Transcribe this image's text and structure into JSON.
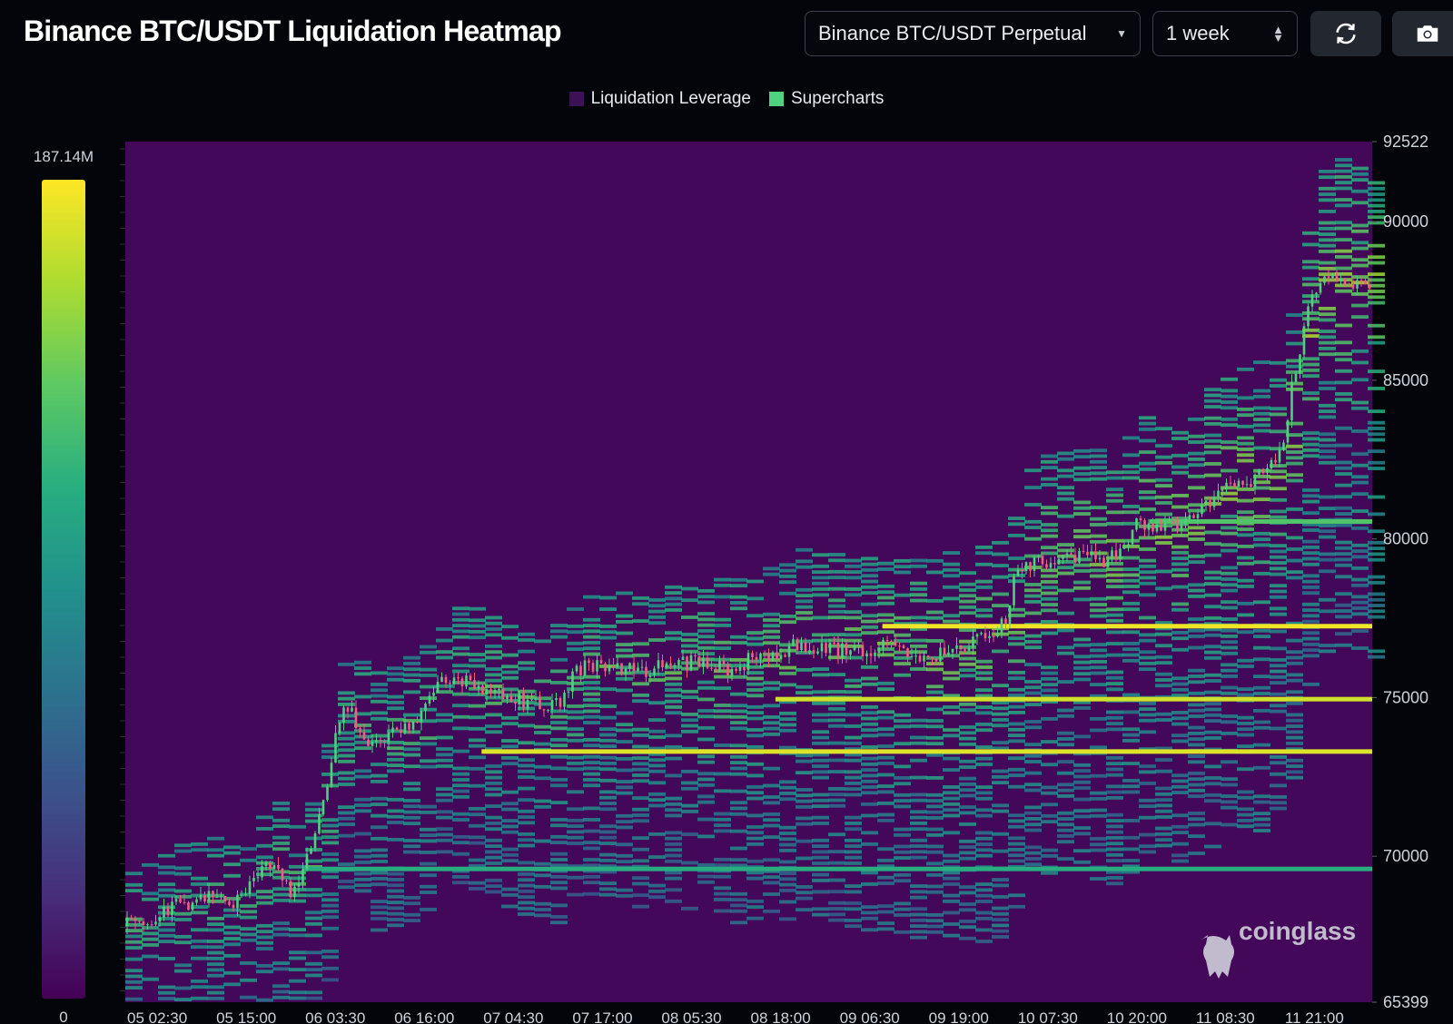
{
  "header": {
    "title": "Binance BTC/USDT Liquidation Heatmap",
    "market_select": "Binance BTC/USDT Perpetual",
    "range_select": "1 week",
    "refresh_icon": "refresh-icon",
    "camera_icon": "camera-icon"
  },
  "chart_data": {
    "type": "heatmap",
    "title": "Binance BTC/USDT Liquidation Heatmap",
    "legend": [
      {
        "name": "Liquidation Leverage",
        "color": "#3d1158"
      },
      {
        "name": "Supercharts",
        "color": "#4fd17f"
      }
    ],
    "colorscale": {
      "max_label": "187.14M",
      "min_label": "0",
      "stops": [
        "#440154",
        "#472d7b",
        "#3b528b",
        "#2c728e",
        "#21918c",
        "#28ae80",
        "#5ec962",
        "#addc30",
        "#fde725"
      ]
    },
    "y_axis": {
      "ylim": [
        65399,
        92522
      ],
      "tick_labels": [
        "92522",
        "90000",
        "85000",
        "80000",
        "75000",
        "70000",
        "65399"
      ],
      "position": "right"
    },
    "x_axis": {
      "tick_labels": [
        "05 02:30",
        "05 15:00",
        "06 03:30",
        "06 16:00",
        "07 04:30",
        "07 17:00",
        "08 05:30",
        "08 18:00",
        "09 06:30",
        "09 19:00",
        "10 07:30",
        "10 20:00",
        "11 08:30",
        "11 21:00"
      ]
    },
    "price_series": {
      "name": "BTC/USDT",
      "x": [
        0,
        0.3,
        0.6,
        1.0,
        1.25,
        1.45,
        1.65,
        1.85,
        2.0,
        2.2,
        2.4,
        2.5,
        2.7,
        3.0,
        3.3,
        3.5,
        3.8,
        4.0,
        4.3,
        4.6,
        4.9,
        5.0,
        5.2,
        5.5,
        5.8,
        6.0,
        6.4,
        6.8,
        7.1,
        7.3,
        7.5,
        7.8,
        8.0,
        8.2,
        8.5,
        8.8,
        9.0,
        9.2,
        9.5,
        9.7,
        9.9,
        10.0,
        10.2,
        10.5,
        10.8,
        11.0,
        11.2,
        11.4,
        11.6,
        11.8,
        12.0,
        12.2,
        12.4,
        12.6,
        12.8,
        13.0,
        13.1,
        13.2,
        13.3,
        13.5,
        13.7
      ],
      "close": [
        67800,
        68100,
        68500,
        68700,
        68600,
        69200,
        69800,
        68900,
        69600,
        71500,
        74200,
        74800,
        73500,
        73900,
        74300,
        75600,
        75500,
        75300,
        75000,
        74800,
        74900,
        75600,
        76100,
        75900,
        75800,
        76000,
        76100,
        75900,
        76300,
        76200,
        76700,
        76600,
        76500,
        76400,
        76600,
        76500,
        76200,
        76400,
        76700,
        76900,
        77500,
        79000,
        79200,
        79500,
        79400,
        79300,
        79800,
        80600,
        80200,
        80500,
        80900,
        81200,
        81800,
        81600,
        82400,
        82700,
        84800,
        86200,
        87500,
        88300,
        88000
      ],
      "color_up": "#4fd17f",
      "color_down": "#f0607f"
    },
    "annotations": [
      "coinglass"
    ]
  }
}
